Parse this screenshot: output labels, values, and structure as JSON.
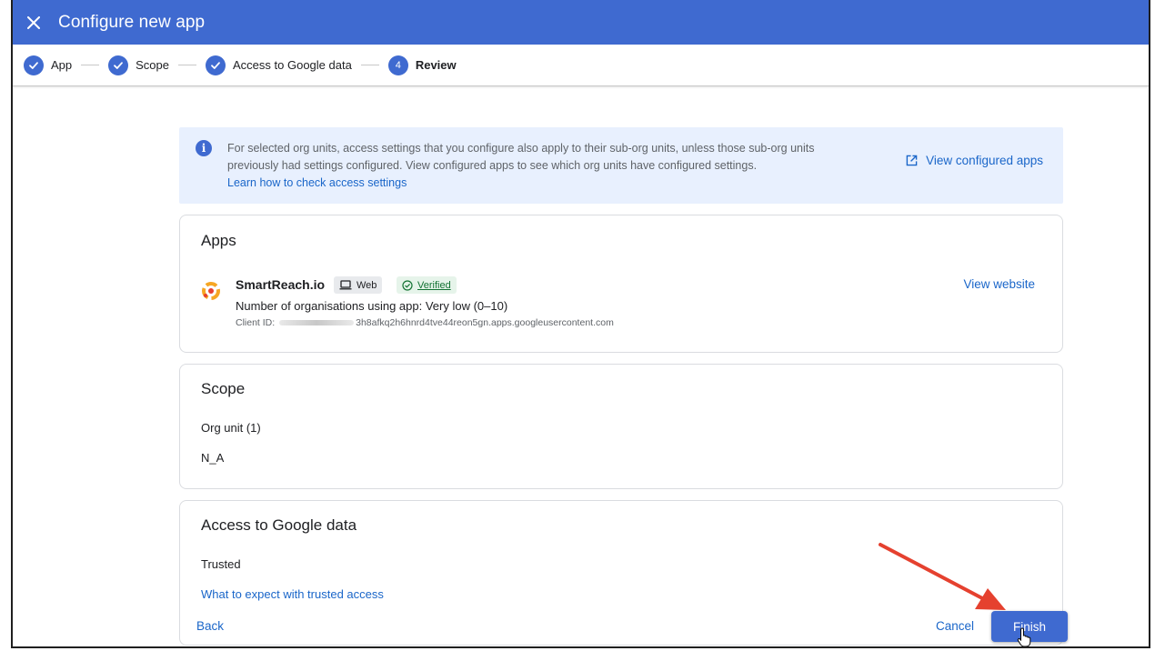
{
  "header": {
    "title": "Configure new app",
    "close_icon": "close-icon"
  },
  "stepper": {
    "steps": [
      {
        "label": "App",
        "state": "done"
      },
      {
        "label": "Scope",
        "state": "done"
      },
      {
        "label": "Access to Google data",
        "state": "done"
      },
      {
        "label": "Review",
        "state": "active",
        "number": "4"
      }
    ]
  },
  "banner": {
    "text": "For selected org units, access settings that you configure also apply to their sub-org units, unless those sub-org units previously had settings configured. View configured apps to see which org units have configured settings.",
    "link": "Learn how to check access settings",
    "action": "View configured apps"
  },
  "apps": {
    "title": "Apps",
    "app_name": "SmartReach.io",
    "platform_chip": "Web",
    "verified_chip": "Verified",
    "orgs_text": "Number of organisations using app: Very low (0–10)",
    "client_id_label": "Client ID:",
    "client_id_value": "3h8afkq2h6hnrd4tve44reon5gn.apps.googleusercontent.com",
    "view_website": "View website"
  },
  "scope": {
    "title": "Scope",
    "org_unit_label": "Org unit (1)",
    "org_unit_value": "N_A"
  },
  "access": {
    "title": "Access to Google data",
    "status": "Trusted",
    "link": "What to expect with trusted access"
  },
  "footer": {
    "back": "Back",
    "cancel": "Cancel",
    "finish": "Finish"
  },
  "colors": {
    "brand": "#3f6ad0",
    "link": "#1a66c9",
    "banner_bg": "#e8f0fe",
    "verified_bg": "#e6f4ea",
    "annotation_arrow": "#e5412f"
  }
}
